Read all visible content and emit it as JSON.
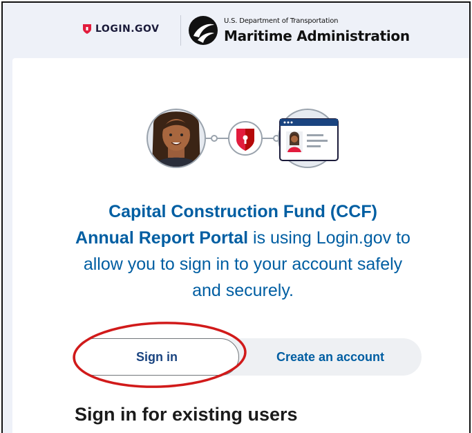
{
  "header": {
    "login_gov_logo_text": "LOGIN.GOV",
    "agency_dept": "U.S. Department of Transportation",
    "agency_name": "Maritime Administration"
  },
  "intro": {
    "app_name_line1": "Capital Construction Fund (CCF)",
    "app_name_line2": "Annual Report Portal",
    "rest": " is using Login.gov to allow you to sign in to your account safely and securely."
  },
  "tabs": {
    "sign_in": "Sign in",
    "create_account": "Create an account"
  },
  "section": {
    "title": "Sign in for existing users"
  },
  "colors": {
    "brand_red": "#e21c3d",
    "link_blue": "#005ea2",
    "annotation_red": "#d11a1a"
  },
  "icons": [
    "login-gov-shield-icon",
    "dot-logo-icon",
    "user-avatar-icon",
    "lock-shield-icon",
    "id-card-icon"
  ]
}
